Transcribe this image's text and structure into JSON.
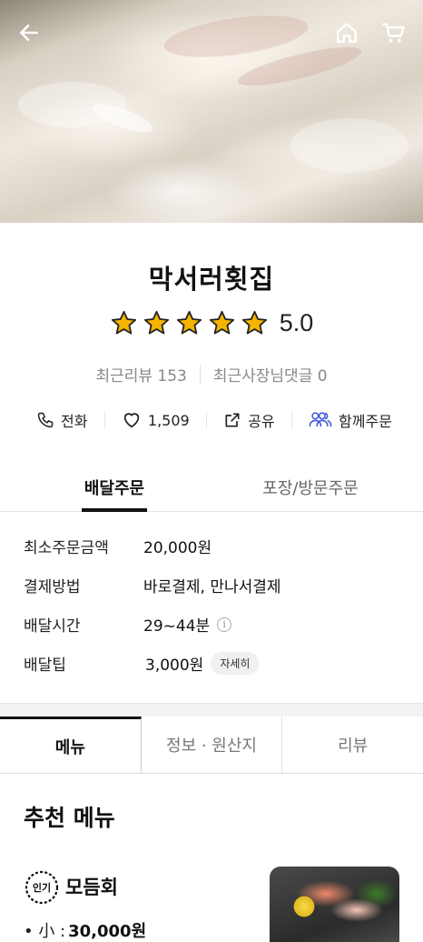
{
  "header": {
    "back_icon": "back-arrow-icon",
    "home_icon": "home-icon",
    "cart_icon": "cart-icon"
  },
  "store": {
    "name": "막서러횟집",
    "rating": "5.0",
    "rating_stars": 5,
    "star_color": "#f5b400",
    "recent_reviews": "최근리뷰 153",
    "owner_comments": "최근사장님댓글 0"
  },
  "actions": {
    "call": "전화",
    "likes": "1,509",
    "share": "공유",
    "group_order": "함께주문",
    "group_color": "#3d5bd9"
  },
  "order_tabs": {
    "delivery": "배달주문",
    "pickup": "포장/방문주문"
  },
  "order_info": [
    {
      "label": "최소주문금액",
      "value": "20,000원"
    },
    {
      "label": "결제방법",
      "value": "바로결제, 만나서결제"
    },
    {
      "label": "배달시간",
      "value": "29~44분"
    },
    {
      "label": "배달팁",
      "value": "3,000원",
      "badge": "자세히"
    }
  ],
  "main_tabs": {
    "menu": "메뉴",
    "info": "정보 · 원산지",
    "review": "리뷰"
  },
  "recommended": {
    "title": "추천 메뉴",
    "items": [
      {
        "badge": "인기",
        "name": "모듬회",
        "size": "• 小 :",
        "price": "30,000원"
      }
    ]
  }
}
